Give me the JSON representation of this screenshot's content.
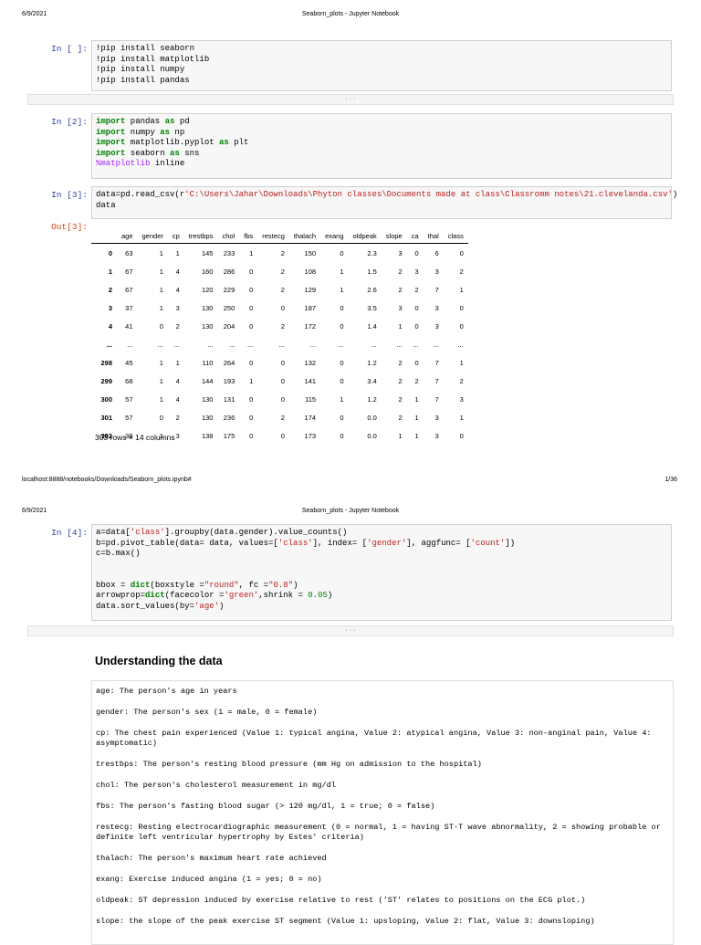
{
  "page1": {
    "date": "6/9/2021",
    "title": "Seaborn_plots - Jupyter Notebook",
    "footer_url": "localhost:8888/notebooks/Downloads/Seaborn_plots.ipynb#",
    "footer_page": "1/36"
  },
  "page2": {
    "date": "6/9/2021",
    "title": "Seaborn_plots - Jupyter Notebook"
  },
  "collapsed_label": "· · ·",
  "cells": [
    {
      "prompt": "In [ ]:",
      "lines": [
        [
          [
            "t",
            "!pip install seaborn"
          ]
        ],
        [
          [
            "t",
            "!pip install matplotlib"
          ]
        ],
        [
          [
            "t",
            "!pip install numpy"
          ]
        ],
        [
          [
            "t",
            "!pip install pandas"
          ]
        ]
      ]
    },
    {
      "prompt": "In [2]:",
      "lines": [
        [
          [
            "kw",
            "import"
          ],
          [
            "t",
            " pandas "
          ],
          [
            "kw",
            "as"
          ],
          [
            "t",
            " pd"
          ]
        ],
        [
          [
            "kw",
            "import"
          ],
          [
            "t",
            " numpy "
          ],
          [
            "kw",
            "as"
          ],
          [
            "t",
            " np"
          ]
        ],
        [
          [
            "kw",
            "import"
          ],
          [
            "t",
            " matplotlib.pyplot "
          ],
          [
            "kw",
            "as"
          ],
          [
            "t",
            " plt"
          ]
        ],
        [
          [
            "kw",
            "import"
          ],
          [
            "t",
            " seaborn "
          ],
          [
            "kw",
            "as"
          ],
          [
            "t",
            " sns"
          ]
        ],
        [
          [
            "mag",
            "%matplotlib"
          ],
          [
            "t",
            " inline"
          ]
        ]
      ]
    },
    {
      "prompt": "In [3]:",
      "lines": [
        [
          [
            "t",
            "data=pd.read_csv(r"
          ],
          [
            "str",
            "'C:\\Users\\Jahar\\Downloads\\Phyton classes\\Documents made at class\\Classromm notes\\21.clevelanda.csv'"
          ],
          [
            "t",
            ")"
          ]
        ],
        [
          [
            "t",
            "data"
          ]
        ]
      ]
    },
    {
      "prompt": "In [4]:",
      "lines": [
        [
          [
            "t",
            "a=data["
          ],
          [
            "str",
            "'class'"
          ],
          [
            "t",
            "].groupby(data.gender).value_counts()"
          ]
        ],
        [
          [
            "t",
            "b=pd.pivot_table(data= data, values=["
          ],
          [
            "str",
            "'class'"
          ],
          [
            "t",
            "], index= ["
          ],
          [
            "str",
            "'gender'"
          ],
          [
            "t",
            "], aggfunc= ["
          ],
          [
            "str",
            "'count'"
          ],
          [
            "t",
            "])"
          ]
        ],
        [
          [
            "t",
            "c=b.max()"
          ]
        ],
        [
          [
            "t",
            ""
          ]
        ],
        [
          [
            "t",
            ""
          ]
        ],
        [
          [
            "t",
            "bbox = "
          ],
          [
            "kw",
            "dict"
          ],
          [
            "t",
            "(boxstyle ="
          ],
          [
            "str",
            "\"round\""
          ],
          [
            "t",
            ", fc ="
          ],
          [
            "str",
            "\"0.8\""
          ],
          [
            "t",
            ")"
          ]
        ],
        [
          [
            "t",
            "arrowprop="
          ],
          [
            "kw",
            "dict"
          ],
          [
            "t",
            "(facecolor ="
          ],
          [
            "str",
            "'green'"
          ],
          [
            "t",
            ",shrink = "
          ],
          [
            "num",
            "0.05"
          ],
          [
            "t",
            ")"
          ]
        ],
        [
          [
            "t",
            "data.sort_values(by="
          ],
          [
            "str",
            "'age'"
          ],
          [
            "t",
            ")"
          ]
        ]
      ]
    }
  ],
  "out3": {
    "prompt": "Out[3]:",
    "columns": [
      "",
      "age",
      "gender",
      "cp",
      "trestbps",
      "chol",
      "fbs",
      "restecg",
      "thalach",
      "exang",
      "oldpeak",
      "slope",
      "ca",
      "thal",
      "class"
    ],
    "rows": [
      [
        "0",
        "63",
        "1",
        "1",
        "145",
        "233",
        "1",
        "2",
        "150",
        "0",
        "2.3",
        "3",
        "0",
        "6",
        "0"
      ],
      [
        "1",
        "67",
        "1",
        "4",
        "160",
        "286",
        "0",
        "2",
        "108",
        "1",
        "1.5",
        "2",
        "3",
        "3",
        "2"
      ],
      [
        "2",
        "67",
        "1",
        "4",
        "120",
        "229",
        "0",
        "2",
        "129",
        "1",
        "2.6",
        "2",
        "2",
        "7",
        "1"
      ],
      [
        "3",
        "37",
        "1",
        "3",
        "130",
        "250",
        "0",
        "0",
        "187",
        "0",
        "3.5",
        "3",
        "0",
        "3",
        "0"
      ],
      [
        "4",
        "41",
        "0",
        "2",
        "130",
        "204",
        "0",
        "2",
        "172",
        "0",
        "1.4",
        "1",
        "0",
        "3",
        "0"
      ],
      [
        "...",
        "...",
        "...",
        "...",
        "...",
        "...",
        "...",
        "...",
        "...",
        "...",
        "...",
        "...",
        "...",
        "...",
        "..."
      ],
      [
        "298",
        "45",
        "1",
        "1",
        "110",
        "264",
        "0",
        "0",
        "132",
        "0",
        "1.2",
        "2",
        "0",
        "7",
        "1"
      ],
      [
        "299",
        "68",
        "1",
        "4",
        "144",
        "193",
        "1",
        "0",
        "141",
        "0",
        "3.4",
        "2",
        "2",
        "7",
        "2"
      ],
      [
        "300",
        "57",
        "1",
        "4",
        "130",
        "131",
        "0",
        "0",
        "115",
        "1",
        "1.2",
        "2",
        "1",
        "7",
        "3"
      ],
      [
        "301",
        "57",
        "0",
        "2",
        "130",
        "236",
        "0",
        "2",
        "174",
        "0",
        "0.0",
        "2",
        "1",
        "3",
        "1"
      ],
      [
        "302",
        "38",
        "1",
        "3",
        "138",
        "175",
        "0",
        "0",
        "173",
        "0",
        "0.0",
        "1",
        "1",
        "3",
        "0"
      ]
    ],
    "shape": "303 rows × 14 columns"
  },
  "markdown": {
    "heading": "Understanding the data",
    "items": [
      "age: The person's age in years",
      "gender: The person's sex (1 = male, 0 = female)",
      "cp: The chest pain experienced (Value 1: typical angina, Value 2: atypical angina, Value 3: non-anginal pain, Value 4: asymptomatic)",
      "trestbps: The person's resting blood pressure (mm Hg on admission to the hospital)",
      "chol: The person's cholesterol measurement in mg/dl",
      "fbs: The person's fasting blood sugar (> 120 mg/dl, 1 = true; 0 = false)",
      "restecg: Resting electrocardiographic measurement (0 = normal, 1 = having ST-T wave abnormality, 2 = showing probable or definite left ventricular hypertrophy by Estes' criteria)",
      "thalach: The person's maximum heart rate achieved",
      "exang: Exercise induced angina (1 = yes; 0 = no)",
      "oldpeak: ST depression induced by exercise relative to rest ('ST' relates to positions on the ECG plot.)",
      "slope: the slope of the peak exercise ST segment (Value 1: upsloping, Value 2: flat, Value 3: downsloping)"
    ]
  }
}
